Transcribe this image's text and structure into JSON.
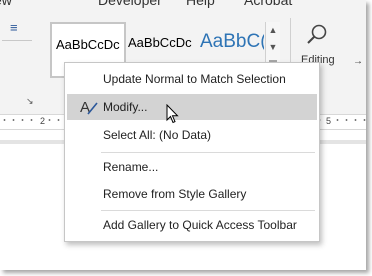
{
  "ribbon": {
    "tabs": [
      "ew",
      "Developer",
      "Help",
      "Acrobat"
    ],
    "left_button_glyph": "≡",
    "launcher_glyph": "↘",
    "styles_gallery": [
      "AaBbCcDc",
      "AaBbCcDc",
      "AaBbC("
    ],
    "scroll_up_glyph": "▲",
    "scroll_down_glyph": "▼",
    "editing_label": "Editing",
    "right_glyph": "→",
    "editing_icon": "magnifier-icon"
  },
  "ruler": {
    "left_number": "2",
    "right_number": "5"
  },
  "context_menu": {
    "items": [
      {
        "label": "Update Normal to Match Selection",
        "icon": null,
        "highlighted": false
      },
      {
        "label": "Modify...",
        "icon": "modify-style-icon",
        "highlighted": true
      },
      {
        "label": "Select All: (No Data)",
        "icon": null,
        "highlighted": false
      },
      {
        "label": "Rename...",
        "icon": null,
        "highlighted": false
      },
      {
        "label": "Remove from Style Gallery",
        "icon": null,
        "highlighted": false
      },
      {
        "label": "Add Gallery to Quick Access Toolbar",
        "icon": null,
        "highlighted": false
      }
    ]
  },
  "colors": {
    "ribbon_bg": "#f3f3f3",
    "menu_highlight": "#d3d3d3",
    "heading_blue": "#2e74b5",
    "accent_blue": "#2b579a"
  }
}
